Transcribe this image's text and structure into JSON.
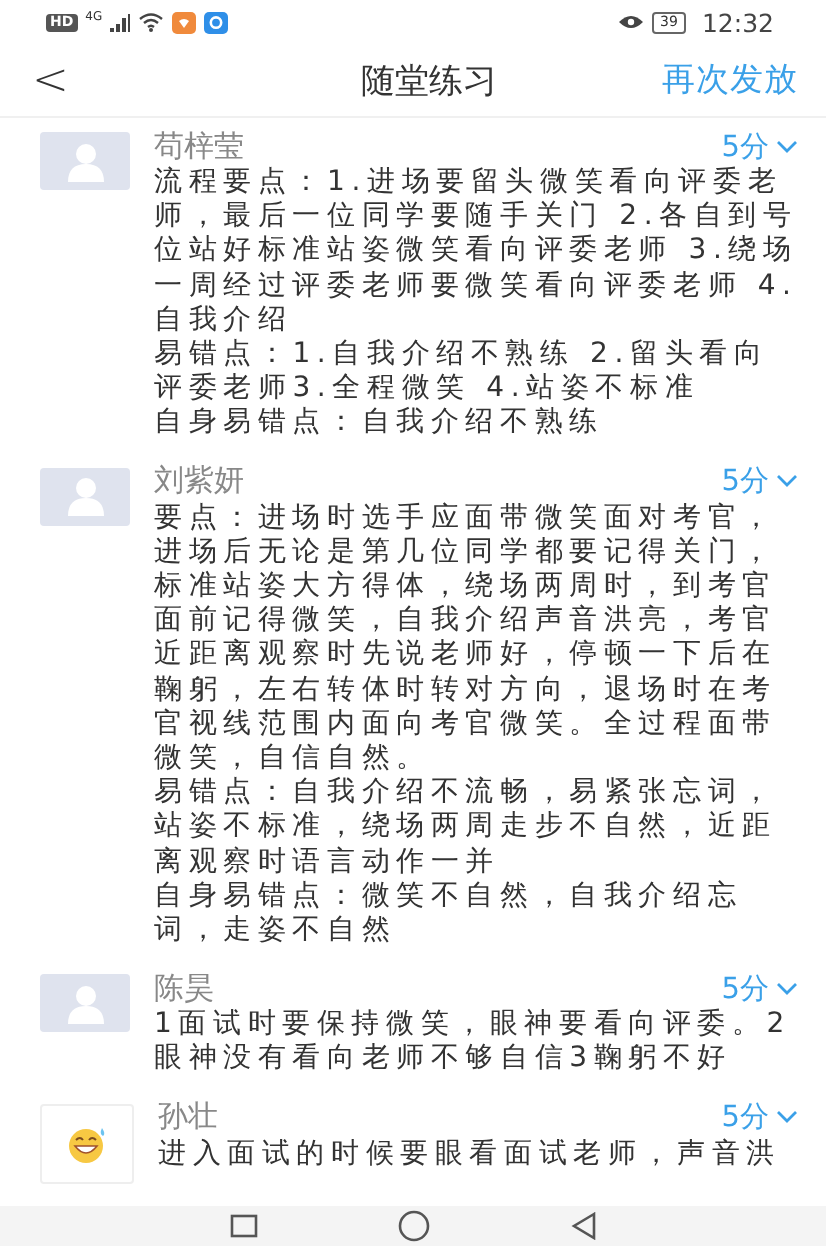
{
  "status_bar": {
    "hd": "HD",
    "network": "4G",
    "battery": "39",
    "time": "12:32"
  },
  "header": {
    "back": "<",
    "title": "随堂练习",
    "action": "再次发放"
  },
  "posts": [
    {
      "name": "苟梓莹",
      "score": "5分",
      "kind": "default",
      "paragraphs": [
        "流程要点：1.进场要留头微笑看向评委老师，最后一位同学要随手关门 2.各自到号位站好标准站姿微笑看向评委老师 3.绕场一周经过评委老师要微笑看向评委老师 4.自我介绍",
        "易错点：1.自我介绍不熟练 2.留头看向评委老师3.全程微笑 4.站姿不标准",
        "自身易错点：自我介绍不熟练"
      ]
    },
    {
      "name": "刘紫妍",
      "score": "5分",
      "kind": "default",
      "paragraphs": [
        "要点：进场时选手应面带微笑面对考官，进场后无论是第几位同学都要记得关门，标准站姿大方得体，绕场两周时，到考官面前记得微笑，自我介绍声音洪亮，考官近距离观察时先说老师好，停顿一下后在鞠躬，左右转体时转对方向，退场时在考官视线范围内面向考官微笑。全过程面带微笑，自信自然。",
        "易错点：自我介绍不流畅，易紧张忘词，站姿不标准，绕场两周走步不自然，近距离观察时语言动作一并",
        "自身易错点：微笑不自然，自我介绍忘词，走姿不自然"
      ]
    },
    {
      "name": "陈昊",
      "score": "5分",
      "kind": "default",
      "paragraphs": [
        "1面试时要保持微笑，眼神要看向评委。2眼神没有看向老师不够自信3鞠躬不好"
      ]
    },
    {
      "name": "孙壮",
      "score": "5分",
      "kind": "emoji",
      "paragraphs": [
        "进入面试的时候要眼看面试老师，声音洪"
      ]
    }
  ]
}
